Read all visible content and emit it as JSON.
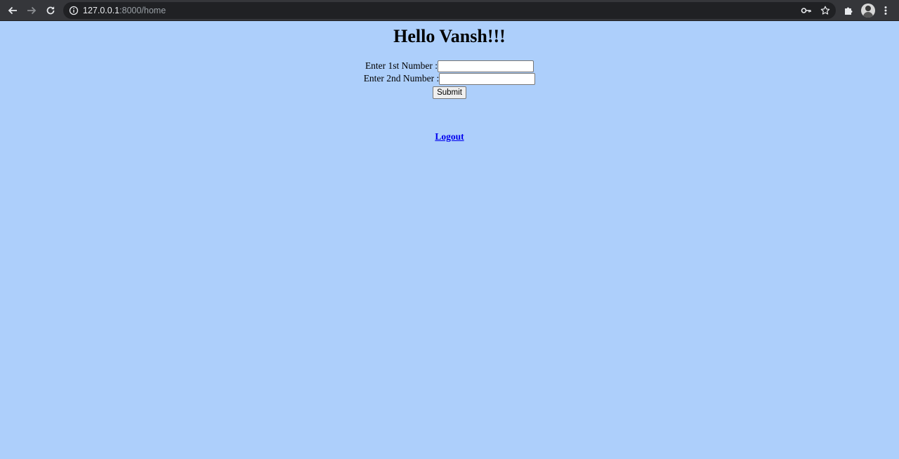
{
  "browser": {
    "url_host": "127.0.0.1",
    "url_rest": ":8000/home",
    "icons": [
      "back-arrow-icon",
      "forward-arrow-icon",
      "reload-icon",
      "info-icon",
      "key-icon",
      "star-icon",
      "extensions-puzzle-icon",
      "profile-avatar",
      "more-vert-icon"
    ]
  },
  "page": {
    "greeting": "Hello Vansh!!!",
    "label_first": "Enter 1st Number :",
    "label_second": "Enter 2nd Number :",
    "first_value": "",
    "second_value": "",
    "submit_label": "Submit",
    "logout_label": "Logout"
  },
  "colors": {
    "page_background": "#adcffb",
    "toolbar_background": "#35363a",
    "link": "#0000ee"
  }
}
